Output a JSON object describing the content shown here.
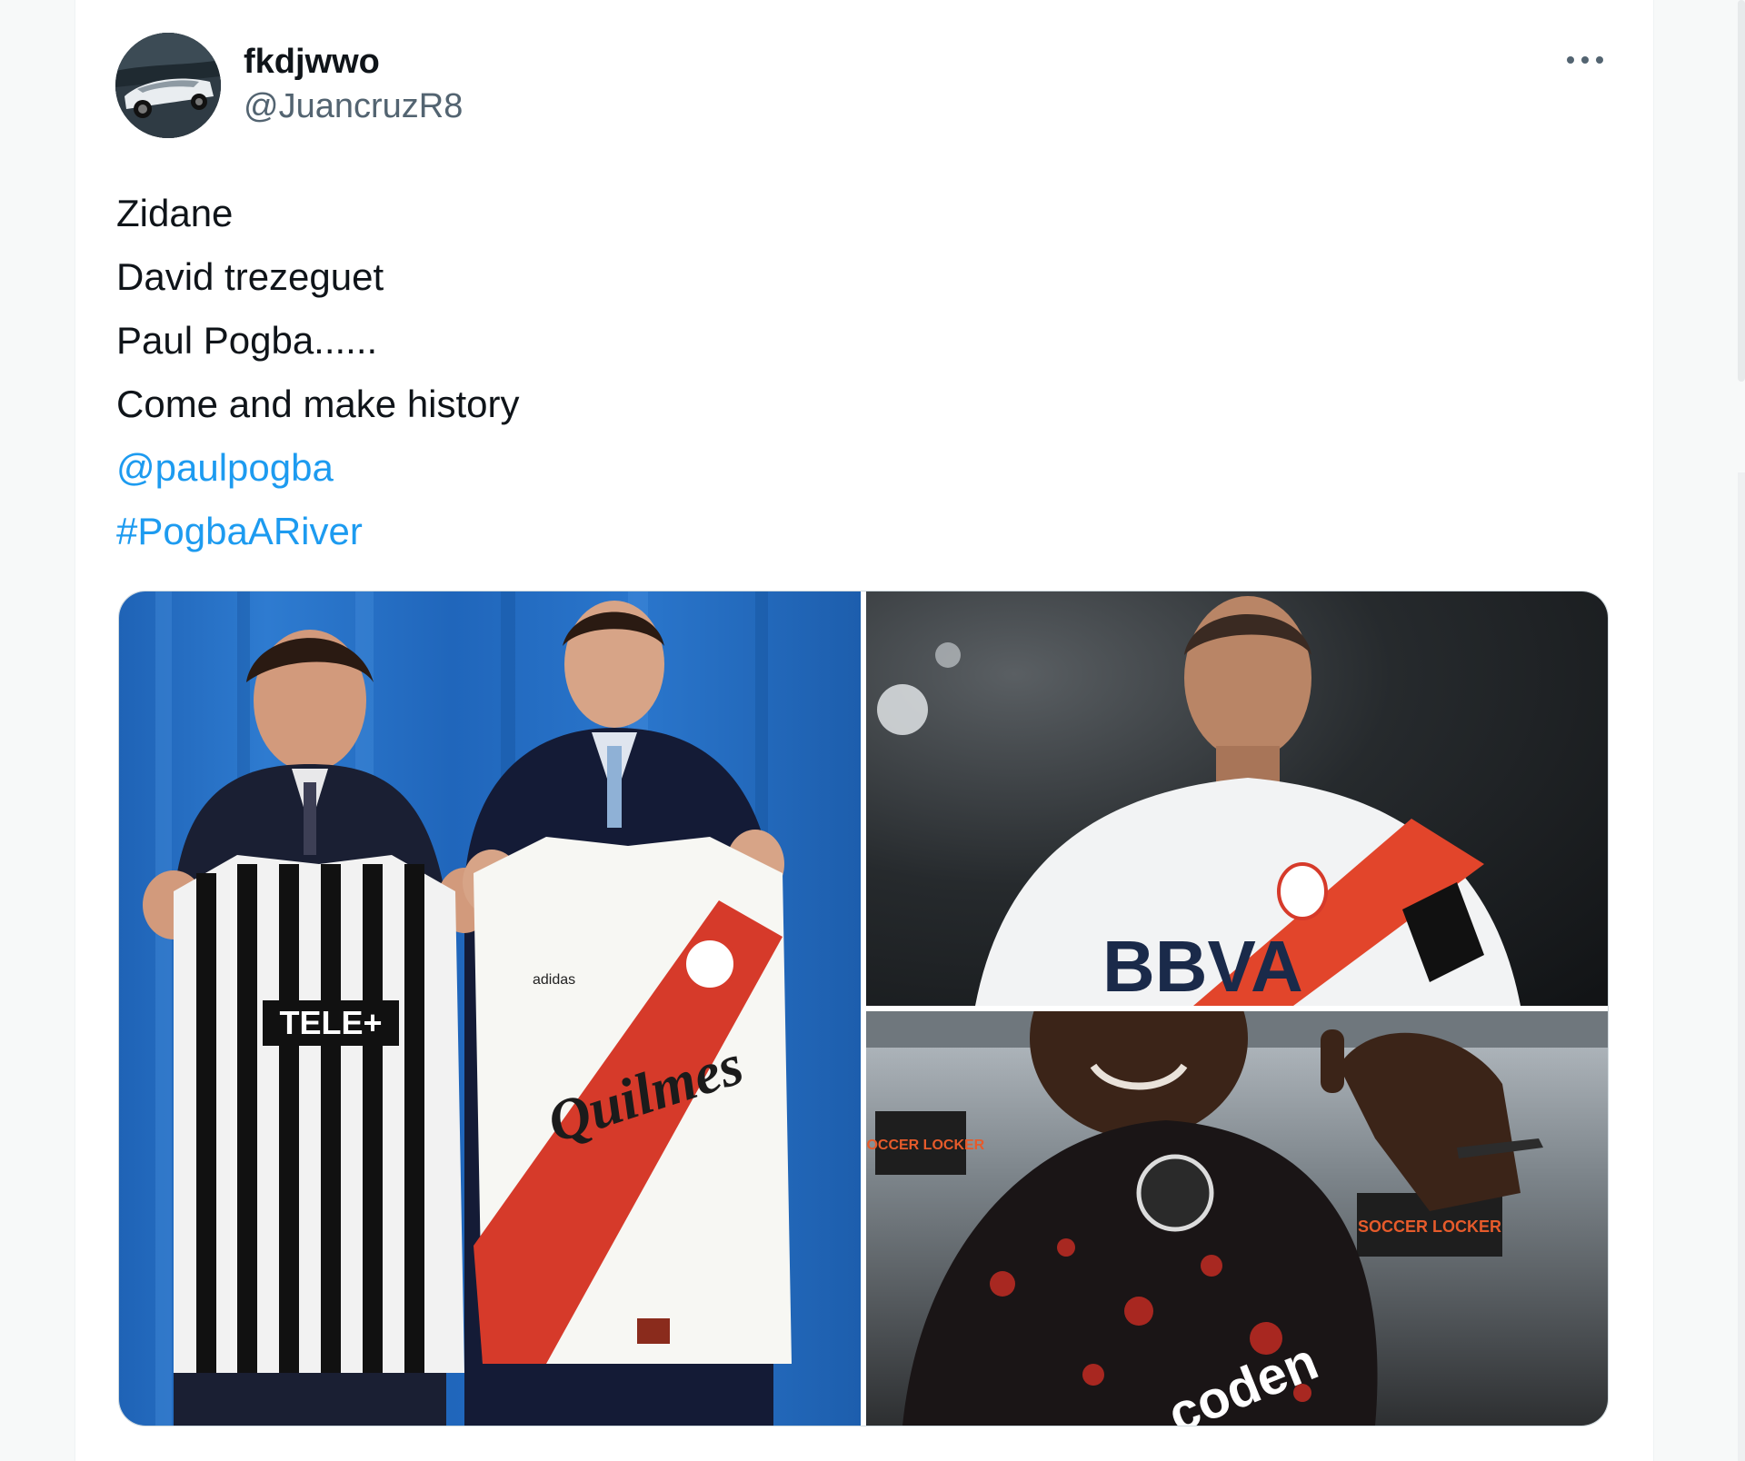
{
  "tweet": {
    "author": {
      "display_name": "fkdjwwo",
      "handle": "@JuancruzR8",
      "avatar_icon": "avatar-car-photo"
    },
    "more_icon": "more-horizontal-icon",
    "text_lines": [
      "Zidane",
      "David trezeguet",
      "Paul Pogba......",
      "Come and make history"
    ],
    "mention": "@paulpogba",
    "hashtag": "#PogbaARiver",
    "media": {
      "left_photo_shirt_text_1": "TELE+",
      "left_photo_shirt_text_2": "Quilmes",
      "left_photo_brand": "adidas",
      "top_right_shirt_text": "BBVA",
      "bottom_right_shirt_text": "coden",
      "bottom_right_sign_text": "SOCCER LOCKER"
    },
    "colors": {
      "link": "#1d9bf0",
      "text": "#0f1419",
      "secondary": "#536471"
    }
  }
}
